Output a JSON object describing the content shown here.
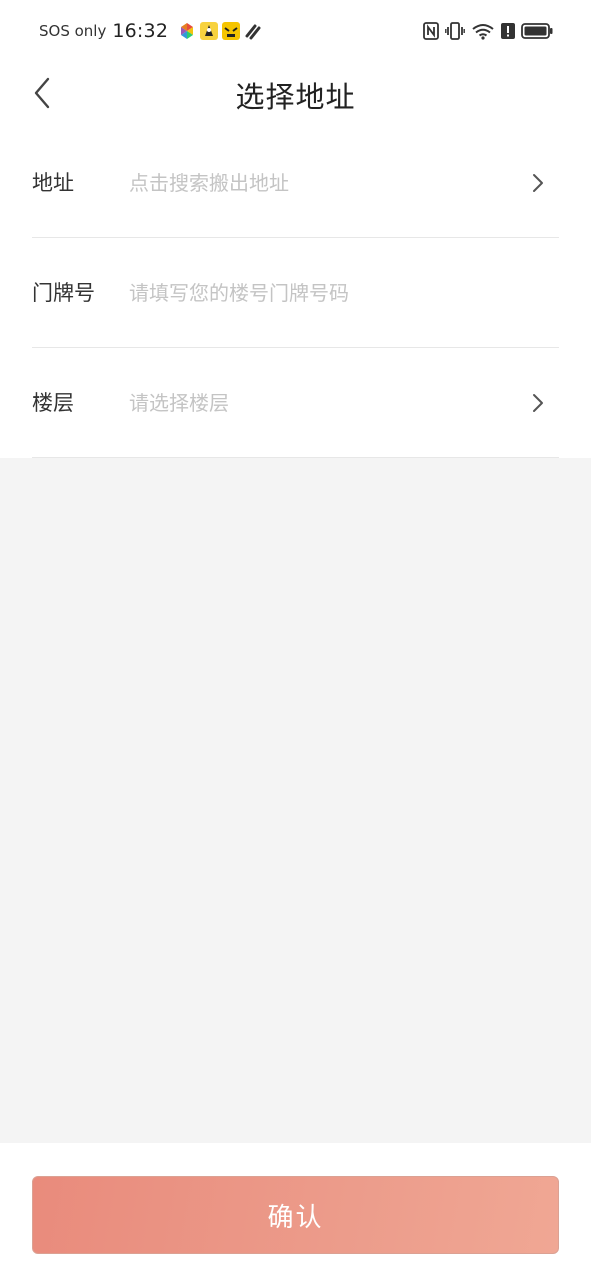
{
  "status_bar": {
    "sos": "SOS only",
    "time": "16:32",
    "app_icons": [
      "colorful-app-icon",
      "yellow-figure-app-icon",
      "yellow-face-app-icon",
      "dashed-app-icon"
    ],
    "right_icons": [
      "nfc-icon",
      "vibrate-icon",
      "wifi-icon",
      "alert-icon",
      "battery-icon"
    ]
  },
  "nav": {
    "back_icon": "chevron-left-icon",
    "title": "选择地址"
  },
  "form": {
    "address": {
      "label": "地址",
      "placeholder": "点击搜索搬出地址"
    },
    "door_number": {
      "label": "门牌号",
      "placeholder": "请填写您的楼号门牌号码"
    },
    "floor": {
      "label": "楼层",
      "placeholder": "请选择楼层"
    }
  },
  "footer": {
    "confirm_label": "确认"
  },
  "colors": {
    "accent": "#e98b7c",
    "placeholder": "#c4c4c4",
    "background": "#f4f4f4",
    "divider": "#e7e7e7"
  }
}
